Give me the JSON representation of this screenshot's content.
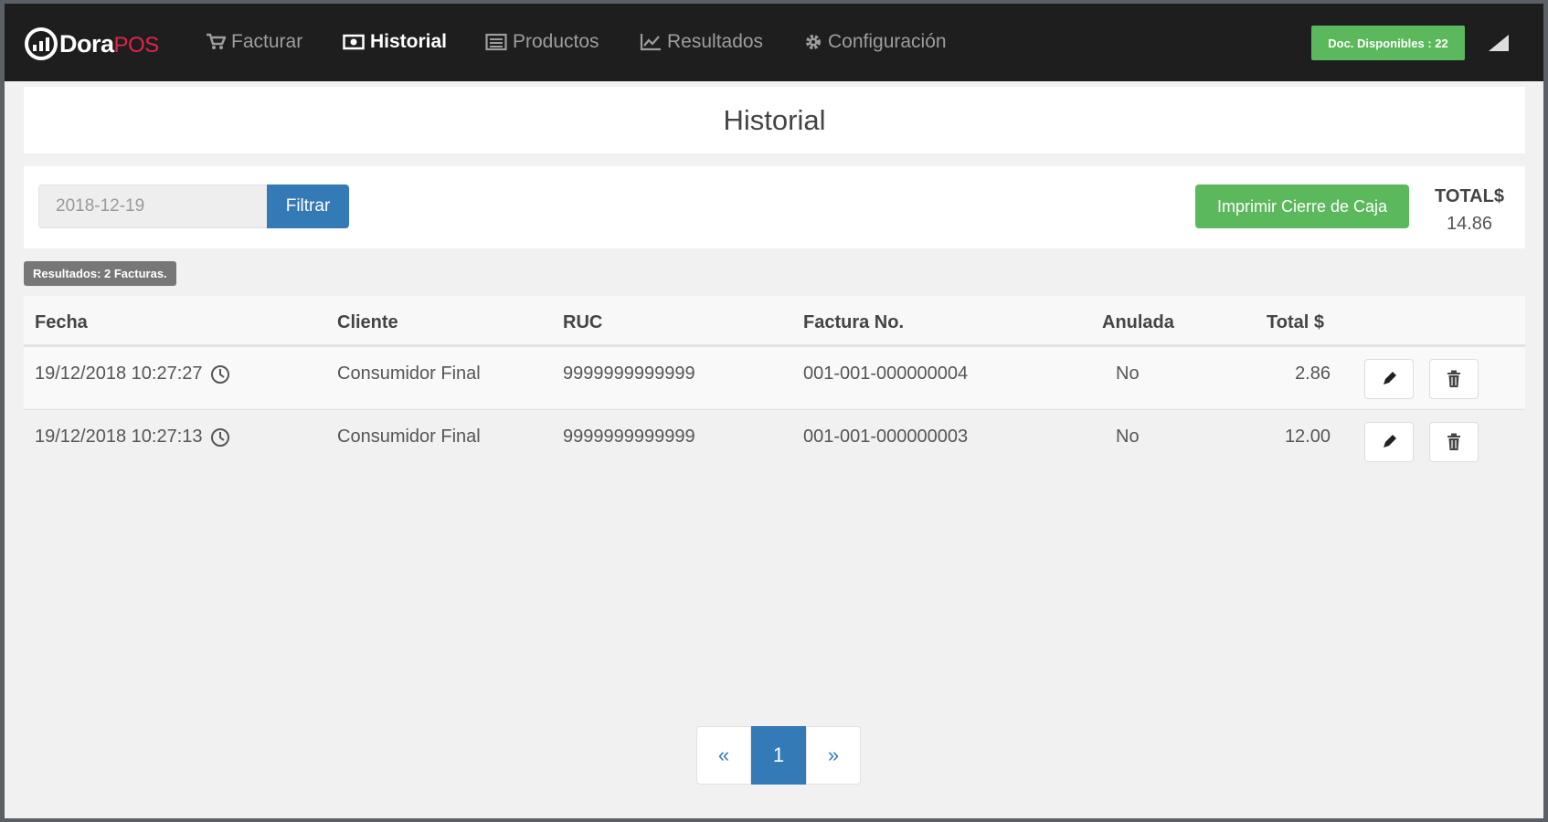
{
  "brand": {
    "name": "Dora",
    "suffix": "POS"
  },
  "nav": {
    "facturar": "Facturar",
    "historial": "Historial",
    "productos": "Productos",
    "resultados": "Resultados",
    "configuracion": "Configuración"
  },
  "docs_badge": "Doc. Disponibles : 22",
  "page_title": "Historial",
  "filter": {
    "date_value": "2018-12-19",
    "filter_button": "Filtrar"
  },
  "print_button": "Imprimir Cierre de Caja",
  "total": {
    "label": "TOTAL$",
    "value": "14.86"
  },
  "results_badge": "Resultados: 2 Facturas.",
  "table": {
    "headers": [
      "Fecha",
      "Cliente",
      "RUC",
      "Factura No.",
      "Anulada",
      "Total $"
    ],
    "rows": [
      {
        "fecha": "19/12/2018 10:27:27",
        "cliente": "Consumidor Final",
        "ruc": "9999999999999",
        "factura": "001-001-000000004",
        "anulada": "No",
        "total": "2.86"
      },
      {
        "fecha": "19/12/2018 10:27:13",
        "cliente": "Consumidor Final",
        "ruc": "9999999999999",
        "factura": "001-001-000000003",
        "anulada": "No",
        "total": "12.00"
      }
    ]
  },
  "pagination": {
    "prev": "«",
    "current": "1",
    "next": "»"
  },
  "colors": {
    "navbar": "#1e1e1e",
    "primary": "#337ab7",
    "success": "#5cb85c",
    "brand_accent": "#e0244a"
  }
}
